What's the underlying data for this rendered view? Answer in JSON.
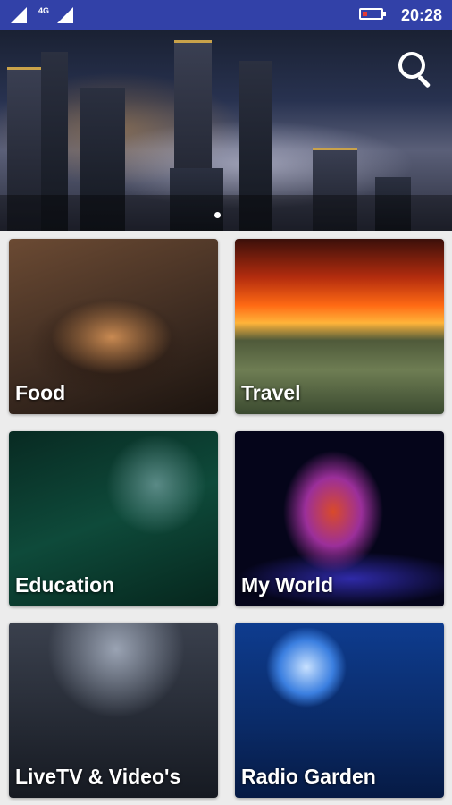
{
  "status_bar": {
    "network": "4G",
    "time": "20:28",
    "battery_level": 0.25,
    "battery_color": "#e53935"
  },
  "banner": {
    "search_icon": "search-icon",
    "carousel_dots": 1
  },
  "tiles": [
    {
      "label": "Food"
    },
    {
      "label": "Travel"
    },
    {
      "label": "Education"
    },
    {
      "label": "My World"
    },
    {
      "label": "LiveTV & Video's"
    },
    {
      "label": "Radio Garden"
    }
  ],
  "colors": {
    "status_bar": "#3241a8",
    "background": "#ececec"
  }
}
